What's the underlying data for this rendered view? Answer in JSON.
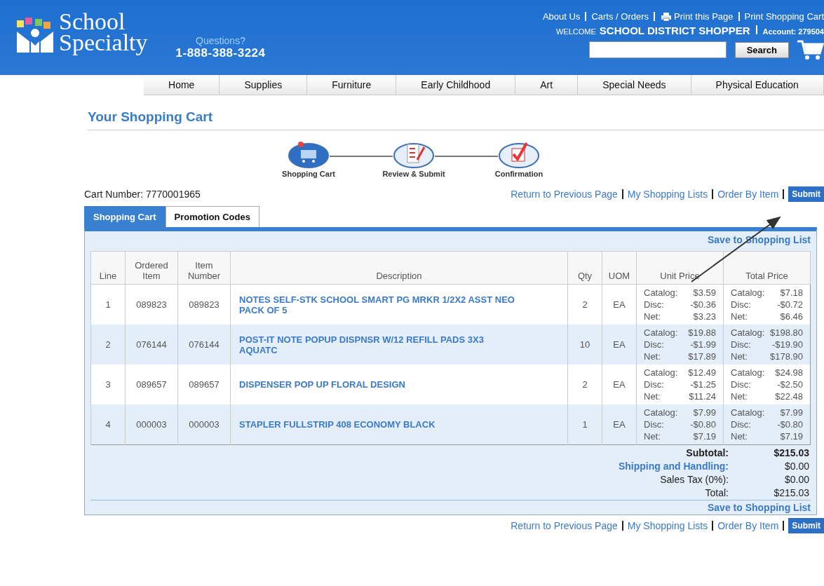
{
  "header": {
    "logo": [
      "School",
      "Specialty"
    ],
    "questions": "Questions?",
    "phone": "1-888-388-3224",
    "top_links": [
      {
        "label": "About Us",
        "kind": "link"
      },
      {
        "label": "Carts / Orders",
        "kind": "link"
      },
      {
        "label": "Print this Page",
        "kind": "print"
      },
      {
        "label": "Print Shopping Cart",
        "kind": "link"
      }
    ],
    "welcome": "WELCOME",
    "user": "SCHOOL DISTRICT SHOPPER",
    "account": "Account: 279504",
    "search": {
      "button": "Search"
    }
  },
  "nav": [
    "Home",
    "Supplies",
    "Furniture",
    "Early Childhood",
    "Art",
    "Special Needs",
    "Physical Education"
  ],
  "page_title": "Your Shopping Cart",
  "steps": [
    {
      "label": "Shopping Cart",
      "kind": "cart",
      "selected": true
    },
    {
      "label": "Review & Submit",
      "kind": "review",
      "selected": false
    },
    {
      "label": "Confirmation",
      "kind": "confirm",
      "selected": false
    }
  ],
  "cart_number": {
    "label": "Cart Number:",
    "value": "7770001965"
  },
  "actions": {
    "links": [
      "Return to Previous Page",
      "My Shopping Lists",
      "Order By Item"
    ],
    "submit": "Submit"
  },
  "tabs": [
    {
      "label": "Shopping Cart",
      "selected": true
    },
    {
      "label": "Promotion Codes",
      "selected": false
    }
  ],
  "save_link_top": "Save to Shopping List",
  "table": {
    "columns": [
      "Line",
      "Ordered Item",
      "Item Number",
      "Description",
      "Qty",
      "UOM",
      "Unit Price",
      "Total Price"
    ],
    "rows": [
      {
        "line": "1",
        "ordered": "089823",
        "item": "089823",
        "description": "NOTES SELF-STK SCHOOL SMART PG MRKR 1/2X2 ASST NEO PACK OF 5",
        "qty": "2",
        "uom": "EA",
        "unit": [
          {
            "label": "Catalog:",
            "value": "$3.59"
          },
          {
            "label": "Disc:",
            "value": "-$0.36"
          },
          {
            "label": "Net:",
            "value": "$3.23"
          }
        ],
        "total": [
          {
            "label": "Catalog:",
            "value": "$7.18"
          },
          {
            "label": "Disc:",
            "value": "-$0.72"
          },
          {
            "label": "Net:",
            "value": "$6.46"
          }
        ]
      },
      {
        "line": "2",
        "ordered": "076144",
        "item": "076144",
        "description": "POST-IT NOTE POPUP DISPNSR W/12 REFILL PADS 3X3 AQUATC",
        "qty": "10",
        "uom": "EA",
        "unit": [
          {
            "label": "Catalog:",
            "value": "$19.88"
          },
          {
            "label": "Disc:",
            "value": "-$1.99"
          },
          {
            "label": "Net:",
            "value": "$17.89"
          }
        ],
        "total": [
          {
            "label": "Catalog:",
            "value": "$198.80"
          },
          {
            "label": "Disc:",
            "value": "-$19.90"
          },
          {
            "label": "Net:",
            "value": "$178.90"
          }
        ]
      },
      {
        "line": "3",
        "ordered": "089657",
        "item": "089657",
        "description": "DISPENSER POP UP FLORAL DESIGN",
        "qty": "2",
        "uom": "EA",
        "unit": [
          {
            "label": "Catalog:",
            "value": "$12.49"
          },
          {
            "label": "Disc:",
            "value": "-$1.25"
          },
          {
            "label": "Net:",
            "value": "$11.24"
          }
        ],
        "total": [
          {
            "label": "Catalog:",
            "value": "$24.98"
          },
          {
            "label": "Disc:",
            "value": "-$2.50"
          },
          {
            "label": "Net:",
            "value": "$22.48"
          }
        ]
      },
      {
        "line": "4",
        "ordered": "000003",
        "item": "000003",
        "description": "STAPLER FULLSTRIP 408 ECONOMY BLACK",
        "qty": "1",
        "uom": "EA",
        "unit": [
          {
            "label": "Catalog:",
            "value": "$7.99"
          },
          {
            "label": "Disc:",
            "value": "-$0.80"
          },
          {
            "label": "Net:",
            "value": "$7.19"
          }
        ],
        "total": [
          {
            "label": "Catalog:",
            "value": "$7.99"
          },
          {
            "label": "Disc:",
            "value": "-$0.80"
          },
          {
            "label": "Net:",
            "value": "$7.19"
          }
        ]
      }
    ]
  },
  "summary": [
    {
      "label": "Subtotal:",
      "value": "$215.03",
      "kind": "bold"
    },
    {
      "label": "Shipping and Handling:",
      "value": "$0.00",
      "kind": "link"
    },
    {
      "label": "Sales Tax (0%):",
      "value": "$0.00",
      "kind": "plain"
    },
    {
      "label": "Total:",
      "value": "$215.03",
      "kind": "plain"
    }
  ],
  "save_link_bottom": "Save to Shopping List",
  "bottom_actions": {
    "links": [
      "Return to Previous Page",
      "My Shopping Lists",
      "Order By Item"
    ],
    "submit": "Submit"
  }
}
